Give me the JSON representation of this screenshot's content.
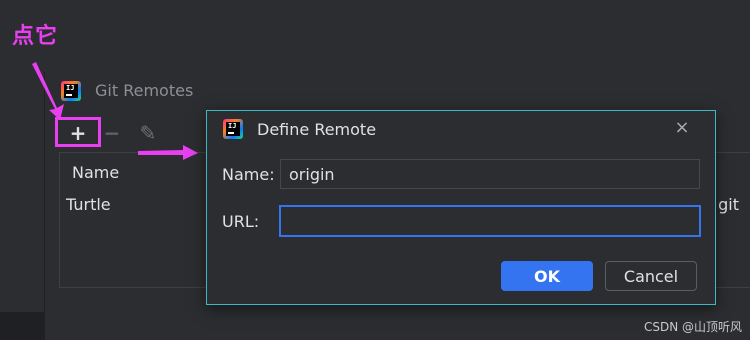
{
  "annotation": {
    "label": "点它"
  },
  "git_remotes": {
    "title": "Git Remotes",
    "toolbar": {
      "add": "+",
      "remove": "−",
      "edit": "✎"
    },
    "table": {
      "header": "Name",
      "rows": [
        {
          "name": "Turtle",
          "url_tail": "git"
        }
      ]
    }
  },
  "dialog": {
    "title": "Define Remote",
    "close_glyph": "×",
    "name_label": "Name:",
    "name_value": "origin",
    "url_label": "URL:",
    "url_value": "",
    "ok_label": "OK",
    "cancel_label": "Cancel"
  },
  "watermark": "CSDN @山顶听风",
  "colors": {
    "accent": "#3574f0",
    "annotation": "#e83ff0",
    "dialog_border": "#3fb8c6",
    "background": "#2b2d30"
  },
  "icons": {
    "app": "intellij-idea-icon",
    "add": "plus-icon",
    "remove": "minus-icon",
    "edit": "pencil-icon",
    "close": "close-icon"
  }
}
